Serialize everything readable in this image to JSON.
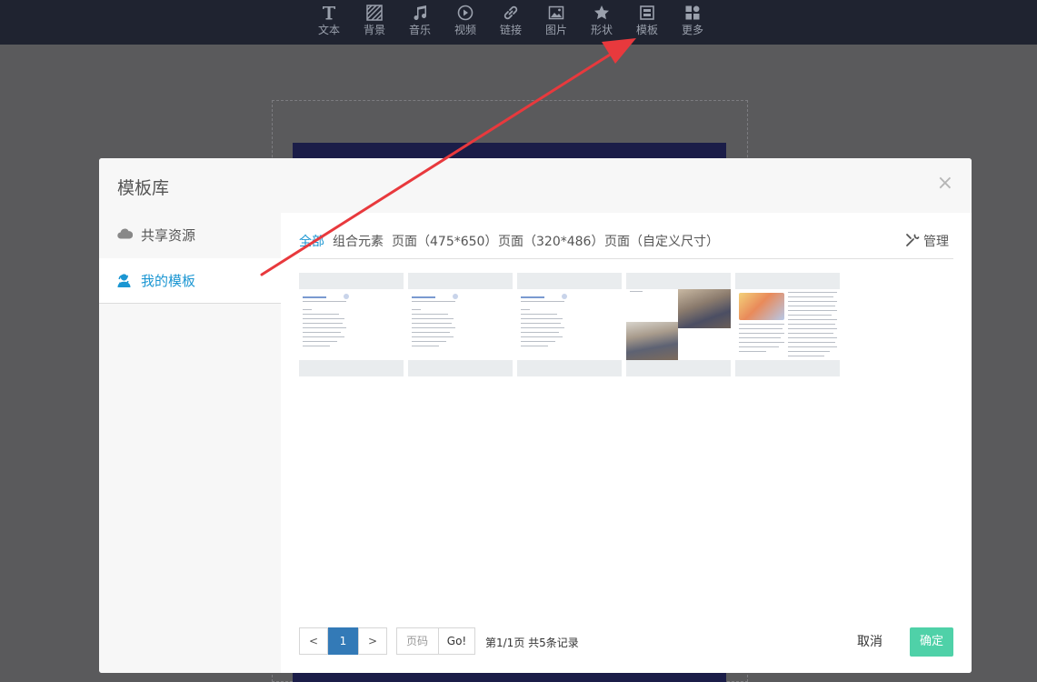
{
  "toolbar": {
    "items": [
      {
        "label": "文本",
        "icon": "text-icon"
      },
      {
        "label": "背景",
        "icon": "background-icon"
      },
      {
        "label": "音乐",
        "icon": "music-icon"
      },
      {
        "label": "视频",
        "icon": "video-icon"
      },
      {
        "label": "链接",
        "icon": "link-icon"
      },
      {
        "label": "图片",
        "icon": "image-icon"
      },
      {
        "label": "形状",
        "icon": "star-icon"
      },
      {
        "label": "模板",
        "icon": "template-icon"
      },
      {
        "label": "更多",
        "icon": "more-icon"
      }
    ]
  },
  "dialog": {
    "title": "模板库",
    "close": "×",
    "sidebar": {
      "shared": "共享资源",
      "mine": "我的模板"
    },
    "filters": [
      "全部",
      "组合元素",
      "页面（475*650）",
      "页面（320*486）",
      "页面（自定义尺寸）"
    ],
    "manage": "管理",
    "pagination": {
      "prev": "<",
      "current": "1",
      "next": ">",
      "page_placeholder": "页码",
      "go": "Go!",
      "info": "第1/1页  共5条记录"
    },
    "cancel": "取消",
    "confirm": "确定"
  },
  "colors": {
    "accent": "#1b96d2",
    "confirm": "#4fd1a8",
    "arrow": "#e8393d",
    "toolbar_bg": "#1f2330"
  }
}
